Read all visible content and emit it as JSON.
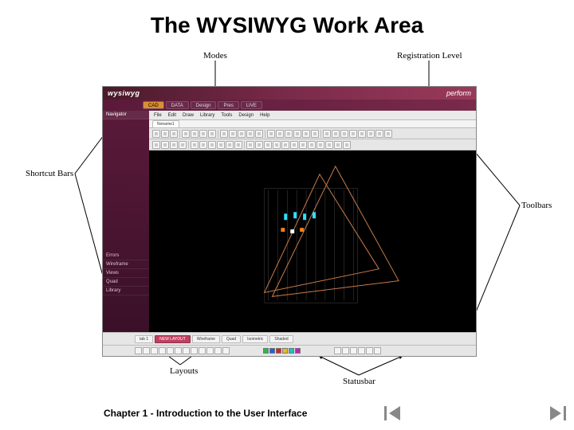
{
  "title": "The WYSIWYG Work Area",
  "chapter": "Chapter 1 - Introduction to the User Interface",
  "labels": {
    "modes": "Modes",
    "registration": "Registration Level",
    "shortcut_bars": "Shortcut Bars",
    "toolbars": "Toolbars",
    "layouts": "Layouts",
    "statusbar": "Statusbar"
  },
  "app": {
    "brand": "wysiwyg",
    "level": "perform",
    "modes": [
      "CAD",
      "DATA",
      "Design",
      "Pres",
      "LIVE"
    ],
    "active_mode_index": 0,
    "menubar": [
      "File",
      "Edit",
      "Draw",
      "Library",
      "Tools",
      "Design",
      "Help"
    ],
    "doc_tabs": [
      "Noname1"
    ],
    "shortcuts_top": [
      "Navigator"
    ],
    "shortcuts_bottom": [
      "Errors",
      "Wireframe",
      "Views",
      "Quad",
      "Library"
    ],
    "layout_tabs": [
      "tab 1",
      "NEW LAYOUT",
      "Wireframe",
      "Quad",
      "Isometric",
      "Shaded"
    ],
    "active_layout_index": 1,
    "status_colors": [
      "#20c040",
      "#2060e0",
      "#e02020",
      "#e0c020",
      "#20c0c0",
      "#c020c0"
    ]
  }
}
